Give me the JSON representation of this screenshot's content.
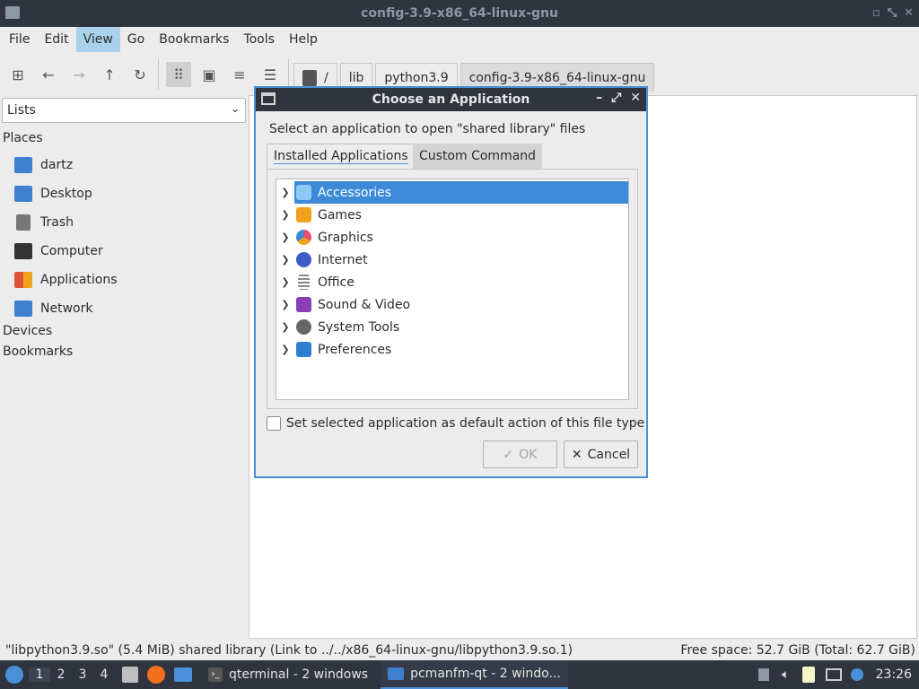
{
  "window": {
    "title": "config-3.9-x86_64-linux-gnu"
  },
  "menu": [
    "File",
    "Edit",
    "View",
    "Go",
    "Bookmarks",
    "Tools",
    "Help"
  ],
  "menu_active": "View",
  "path_crumbs": [
    "/",
    "lib",
    "python3.9",
    "config-3.9-x86_64-linux-gnu"
  ],
  "sidebar": {
    "view_mode": "Lists",
    "places_header": "Places",
    "places": [
      {
        "label": "dartz",
        "icon": "home-folder-icon",
        "color": "#3f7fd0"
      },
      {
        "label": "Desktop",
        "icon": "desktop-folder-icon",
        "color": "#3f7fd0"
      },
      {
        "label": "Trash",
        "icon": "trash-icon",
        "color": "#777777"
      },
      {
        "label": "Computer",
        "icon": "computer-icon",
        "color": "#333333"
      },
      {
        "label": "Applications",
        "icon": "applications-icon",
        "color": "#e0523c"
      },
      {
        "label": "Network",
        "icon": "network-folder-icon",
        "color": "#3f7fd0"
      }
    ],
    "devices_header": "Devices",
    "bookmarks_header": "Bookmarks"
  },
  "status": {
    "left": "\"libpython3.9.so\" (5.4 MiB) shared library (Link to ../../x86_64-linux-gnu/libpython3.9.so.1)",
    "right": "Free space: 52.7 GiB (Total: 62.7 GiB)"
  },
  "dialog": {
    "title": "Choose an Application",
    "prompt": "Select an application to open \"shared library\" files",
    "tabs": [
      "Installed Applications",
      "Custom Command"
    ],
    "categories": [
      {
        "label": "Accessories",
        "icon": "accessories-icon",
        "color": "#3c8ad8"
      },
      {
        "label": "Games",
        "icon": "games-icon",
        "color": "#f0a21e"
      },
      {
        "label": "Graphics",
        "icon": "graphics-icon",
        "color": "#e94b6a"
      },
      {
        "label": "Internet",
        "icon": "internet-icon",
        "color": "#3d5bc4"
      },
      {
        "label": "Office",
        "icon": "office-icon",
        "color": "#888888"
      },
      {
        "label": "Sound & Video",
        "icon": "sound-video-icon",
        "color": "#8a3fb5"
      },
      {
        "label": "System Tools",
        "icon": "system-tools-icon",
        "color": "#666666"
      },
      {
        "label": "Preferences",
        "icon": "preferences-icon",
        "color": "#2f7fd0"
      }
    ],
    "selected_category": "Accessories",
    "default_checkbox_label": "Set selected application as default action of this file type",
    "ok_label": "OK",
    "cancel_label": "Cancel"
  },
  "taskbar": {
    "workspaces": [
      "1",
      "2",
      "3",
      "4"
    ],
    "tasks": [
      {
        "label": "qterminal - 2 windows"
      },
      {
        "label": "pcmanfm-qt - 2 windo..."
      }
    ],
    "clock": "23:26"
  }
}
